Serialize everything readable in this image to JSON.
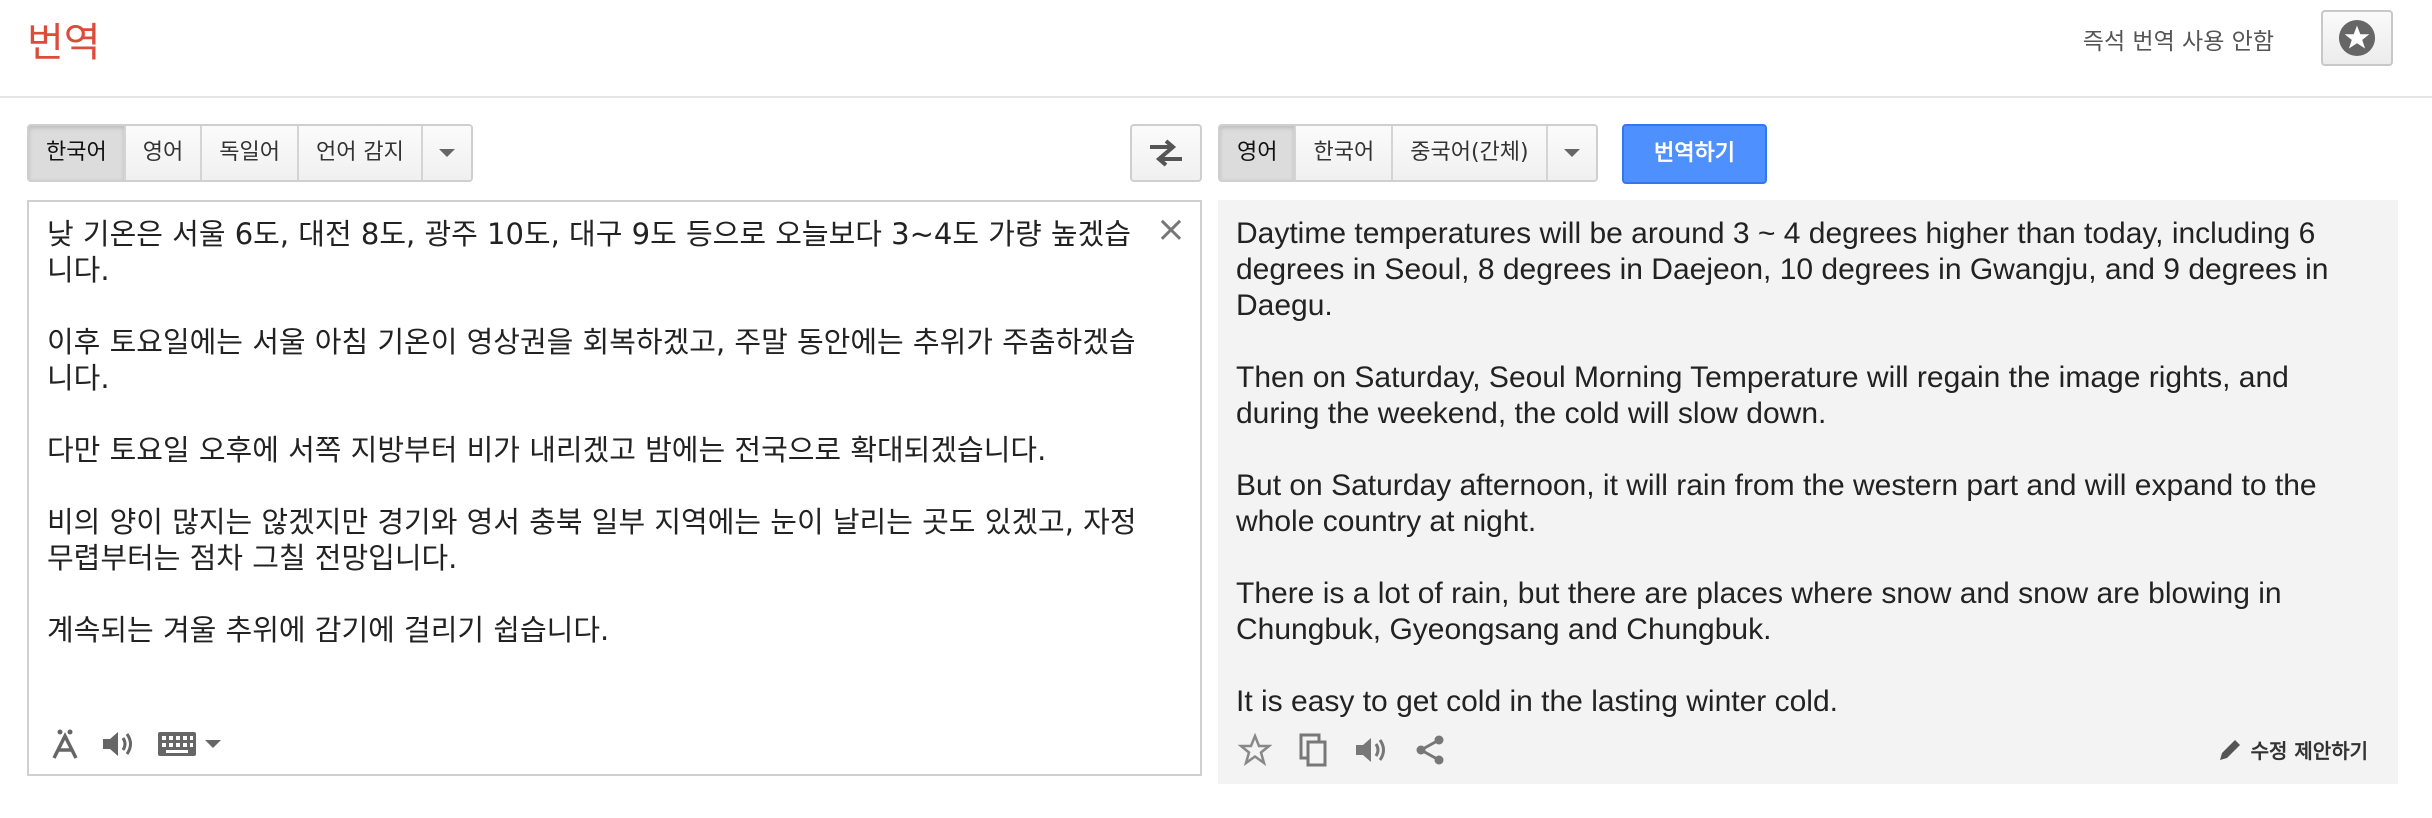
{
  "header": {
    "title": "번역",
    "instant_off": "즉석 번역 사용 안함"
  },
  "source": {
    "languages": [
      {
        "label": "한국어",
        "selected": true
      },
      {
        "label": "영어",
        "selected": false
      },
      {
        "label": "독일어",
        "selected": false
      },
      {
        "label": "언어 감지",
        "selected": false
      }
    ],
    "paragraphs": [
      "낮 기온은 서울 6도, 대전 8도, 광주 10도, 대구 9도 등으로 오늘보다 3~4도 가량 높겠습니다.",
      "이후 토요일에는 서울 아침 기온이 영상권을 회복하겠고, 주말 동안에는 추위가 주춤하겠습니다.",
      "다만 토요일 오후에 서쪽 지방부터 비가 내리겠고 밤에는 전국으로 확대되겠습니다.",
      "비의 양이 많지는 않겠지만 경기와 영서 충북 일부 지역에는 눈이 날리는 곳도 있겠고, 자정 무렵부터는 점차 그칠 전망입니다.",
      "계속되는 겨울 추위에 감기에 걸리기 쉽습니다."
    ],
    "clear_glyph": "×"
  },
  "target": {
    "languages": [
      {
        "label": "영어",
        "selected": true
      },
      {
        "label": "한국어",
        "selected": false
      },
      {
        "label": "중국어(간체)",
        "selected": false
      }
    ],
    "translate_label": "번역하기",
    "paragraphs": [
      "Daytime temperatures will be around 3 ~ 4 degrees higher than today, including 6 degrees in Seoul, 8 degrees in Daejeon, 10 degrees in Gwangju, and 9 degrees in Daegu.",
      "Then on Saturday, Seoul Morning Temperature will regain the image rights, and during the weekend, the cold will slow down.",
      "But on Saturday afternoon, it will rain from the western part and will expand to the whole country at night.",
      "There is a lot of rain, but there are places where snow and snow are blowing in Chungbuk, Gyeongsang and Chungbuk.",
      "It is easy to get cold in the lasting winter cold."
    ],
    "suggest_label": "수정 제안하기"
  },
  "icons": {
    "star": "star-icon",
    "swap": "swap-icon",
    "clear": "close-icon",
    "phonetic": "phonetic-icon",
    "listen": "speaker-icon",
    "keyboard": "keyboard-icon",
    "copy": "copy-icon",
    "share": "share-icon",
    "edit": "pencil-icon"
  },
  "colors": {
    "title_red": "#dd4b39",
    "translate_blue": "#4d90fe"
  }
}
